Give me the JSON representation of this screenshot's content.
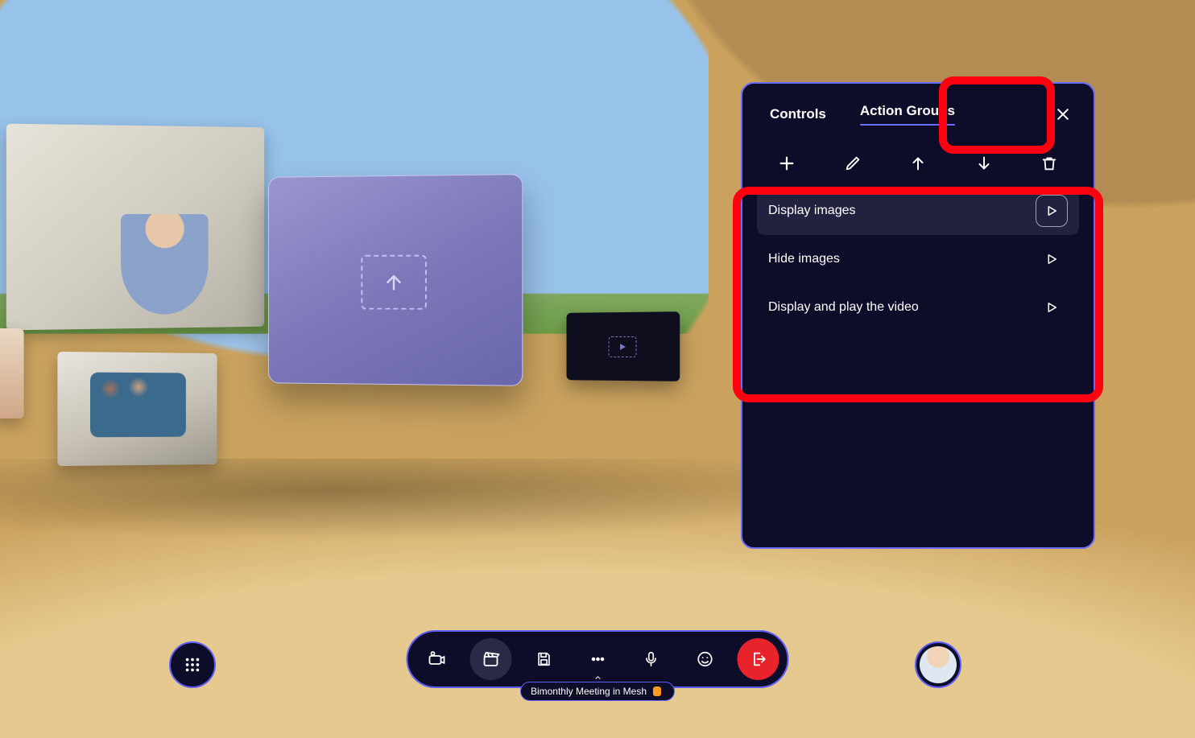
{
  "panel": {
    "tabs": {
      "controls": "Controls",
      "actionGroups": "Action Groups"
    },
    "activeTab": "actionGroups",
    "actions": [
      {
        "label": "Display images",
        "selected": true
      },
      {
        "label": "Hide images",
        "selected": false
      },
      {
        "label": "Display and play the video",
        "selected": false
      }
    ]
  },
  "meeting": {
    "title": "Bimonthly Meeting in Mesh"
  },
  "colors": {
    "accent": "#6a6bff",
    "danger": "#e8232b",
    "highlight": "#ff0010"
  }
}
